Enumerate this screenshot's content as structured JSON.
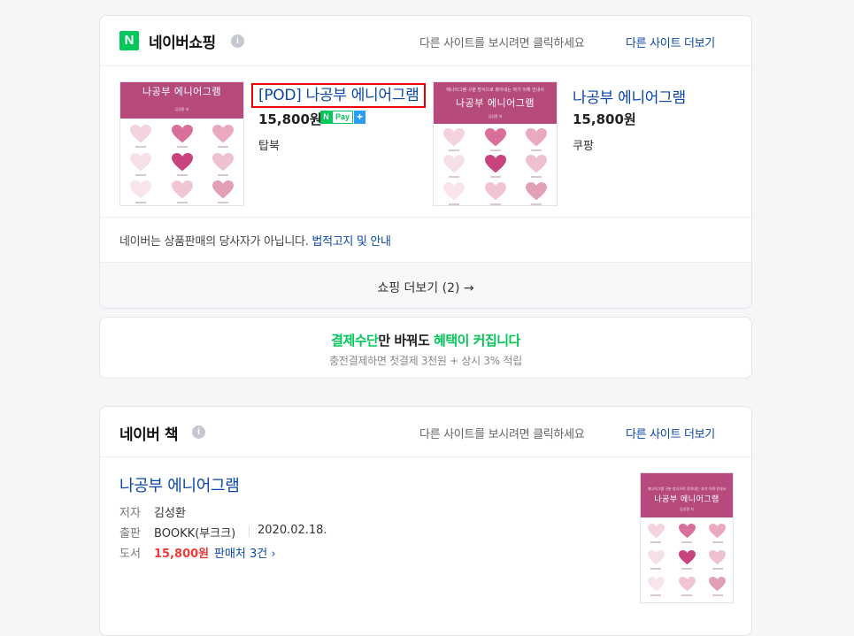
{
  "shopping": {
    "logo_letter": "N",
    "title": "네이버쇼핑",
    "info_icon": "i",
    "hint": "다른 사이트를 보시려면 클릭하세요",
    "more_sites": "다른 사이트 더보기",
    "products": [
      {
        "title": "[POD] 나공부 에니어그램",
        "price": "15,800원",
        "mall": "탑북",
        "npay": true,
        "cover_title": "나공부 에니어그램",
        "cover_author": "김성환 저"
      },
      {
        "title": "나공부 에니어그램",
        "price": "15,800원",
        "mall": "쿠팡",
        "npay": false,
        "cover_subtitle": "에니어그램 구분 방식으로 찾아내는 자기 이해 안내서",
        "cover_title": "나공부 에니어그램",
        "cover_author": "김성환 저"
      }
    ],
    "npay_badge": {
      "n": "N",
      "pay": "Pay",
      "plus": "+"
    },
    "notice_text": "네이버는 상품판매의 당사자가 아닙니다.",
    "notice_link": "법적고지 및 안내",
    "more_button": "쇼핑 더보기 (2)",
    "more_arrow": "→"
  },
  "payment_banner": {
    "highlight1": "결제수단",
    "text1": "만 바꿔도 ",
    "highlight2": "혜택이 커집니다",
    "sub": "충전결제하면 첫결제 3천원 + 상시 3% 적립"
  },
  "book": {
    "title": "네이버 책",
    "info_icon": "i",
    "hint": "다른 사이트를 보시려면 클릭하세요",
    "more_sites": "다른 사이트 더보기",
    "item_title": "나공부 에니어그램",
    "author_label": "저자",
    "author": "김성환",
    "publisher_label": "출판",
    "publisher": "BOOKK(부크크)",
    "date": "2020.02.18.",
    "category_label": "도서",
    "price": "15,800원",
    "sellers": "판매처 3건",
    "sellers_chevron": "›",
    "cover_subtitle": "에니어그램 구분 방식으로 찾아내는 자기 이해 안내서",
    "cover_title": "나공부 에니어그램",
    "cover_author": "김성환 저"
  },
  "colors": {
    "naver_green": "#03c75a",
    "link_blue": "#0a47a8",
    "price_red": "#ef3b39",
    "cover_magenta": "#b64a7c",
    "highlight_red": "#ee0000"
  }
}
